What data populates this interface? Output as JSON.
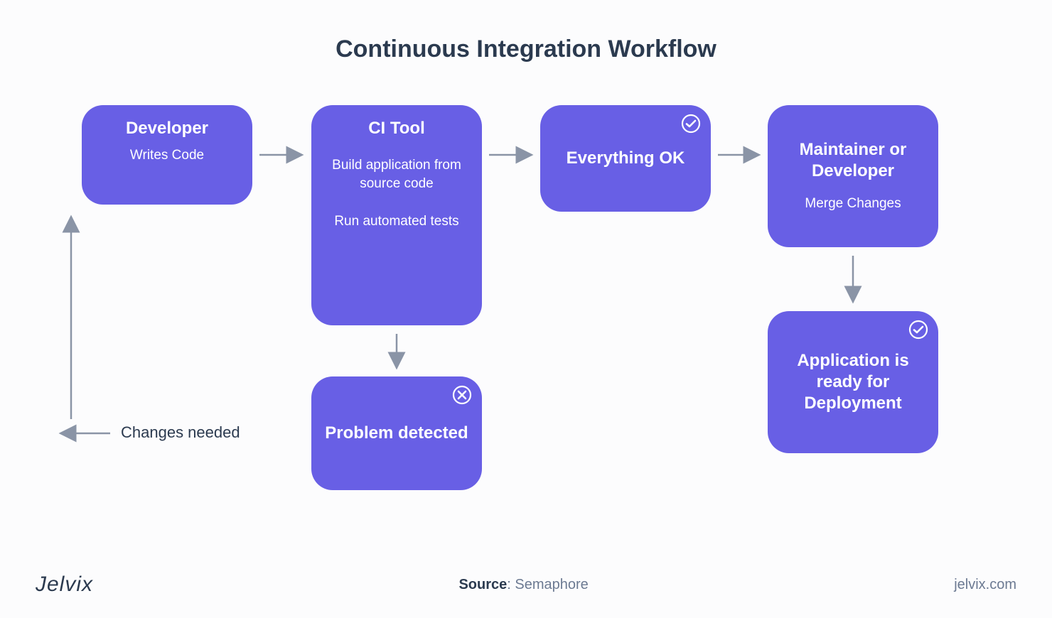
{
  "title": "Continuous Integration Workflow",
  "nodes": {
    "developer": {
      "heading": "Developer",
      "sub": "Writes Code"
    },
    "ci_tool": {
      "heading": "CI Tool",
      "sub1": "Build application from source code",
      "sub2": "Run automated tests"
    },
    "ok": {
      "heading": "Everything OK"
    },
    "maintainer": {
      "heading": "Maintainer or Developer",
      "sub": "Merge Changes"
    },
    "problem": {
      "heading": "Problem detected"
    },
    "ready": {
      "heading": "Application is ready for Deployment"
    }
  },
  "labels": {
    "changes_needed": "Changes needed"
  },
  "footer": {
    "logo": "Jelvix",
    "source_label": "Source",
    "source_value": "Semaphore",
    "url": "jelvix.com"
  },
  "colors": {
    "node_bg": "#685fe5",
    "arrow": "#8a94a6",
    "title": "#2b3a4f",
    "bg": "#fcfcfd"
  }
}
